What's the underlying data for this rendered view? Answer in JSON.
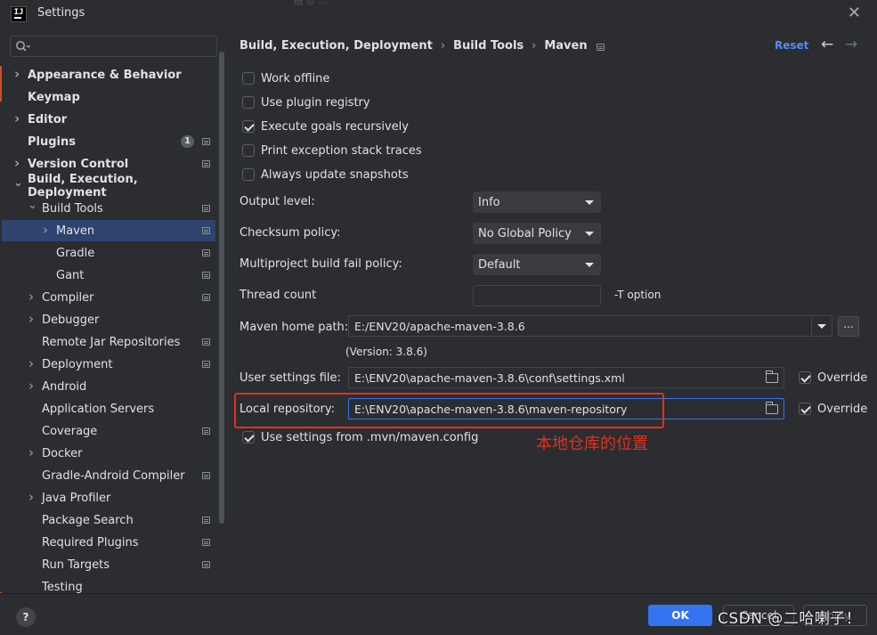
{
  "window": {
    "title": "Settings",
    "close_glyph": "✕",
    "top_hint": "▤ ◎ …"
  },
  "search": {
    "placeholder": ""
  },
  "sidebar": {
    "items": [
      {
        "label": "Appearance & Behavior"
      },
      {
        "label": "Keymap"
      },
      {
        "label": "Editor"
      },
      {
        "label": "Plugins",
        "badge": "1"
      },
      {
        "label": "Version Control"
      },
      {
        "label": "Build, Execution, Deployment"
      },
      {
        "label": "Build Tools"
      },
      {
        "label": "Maven"
      },
      {
        "label": "Gradle"
      },
      {
        "label": "Gant"
      },
      {
        "label": "Compiler"
      },
      {
        "label": "Debugger"
      },
      {
        "label": "Remote Jar Repositories"
      },
      {
        "label": "Deployment"
      },
      {
        "label": "Android"
      },
      {
        "label": "Application Servers"
      },
      {
        "label": "Coverage"
      },
      {
        "label": "Docker"
      },
      {
        "label": "Gradle-Android Compiler"
      },
      {
        "label": "Java Profiler"
      },
      {
        "label": "Package Search"
      },
      {
        "label": "Required Plugins"
      },
      {
        "label": "Run Targets"
      },
      {
        "label": "Testing"
      }
    ]
  },
  "breadcrumb": {
    "items": [
      "Build, Execution, Deployment",
      "Build Tools",
      "Maven"
    ],
    "separator": "›"
  },
  "header": {
    "reset_label": "Reset",
    "back_glyph": "←",
    "forward_glyph": "→"
  },
  "options": [
    {
      "label": "Work offline",
      "checked": false
    },
    {
      "label": "Use plugin registry",
      "checked": false
    },
    {
      "label": "Execute goals recursively",
      "checked": true
    },
    {
      "label": "Print exception stack traces",
      "checked": false
    },
    {
      "label": "Always update snapshots",
      "checked": false
    }
  ],
  "form": {
    "output_level": {
      "label": "Output level:",
      "value": "Info"
    },
    "checksum_policy": {
      "label": "Checksum policy:",
      "value": "No Global Policy"
    },
    "fail_policy": {
      "label": "Multiproject build fail policy:",
      "value": "Default"
    },
    "thread_count": {
      "label": "Thread count",
      "value": "",
      "hint": "-T option"
    },
    "maven_home": {
      "label": "Maven home path:",
      "value": "E:/ENV20/apache-maven-3.8.6",
      "version": "(Version: 3.8.6)",
      "browse_label": "..."
    },
    "user_settings": {
      "label": "User settings file:",
      "value": "E:\\ENV20\\apache-maven-3.8.6\\conf\\settings.xml",
      "override_label": "Override",
      "override_checked": true
    },
    "local_repo": {
      "label": "Local repository:",
      "value": "E:\\ENV20\\apache-maven-3.8.6\\maven-repository",
      "override_label": "Override",
      "override_checked": true
    },
    "mvn_config": {
      "label": "Use settings from .mvn/maven.config",
      "checked": true
    }
  },
  "annotation": {
    "text": "本地仓库的位置",
    "color": "#e0321c"
  },
  "footer": {
    "help_label": "?",
    "ok_label": "OK",
    "cancel_label": "Cancel",
    "apply_label": "Apply"
  },
  "watermark": {
    "text": "CSDN @二哈喇子！"
  },
  "colors": {
    "accent": "#3574f0",
    "selection": "#2e436e",
    "background": "#2b2d30",
    "annotation": "#e0321c",
    "link": "#548af7"
  }
}
